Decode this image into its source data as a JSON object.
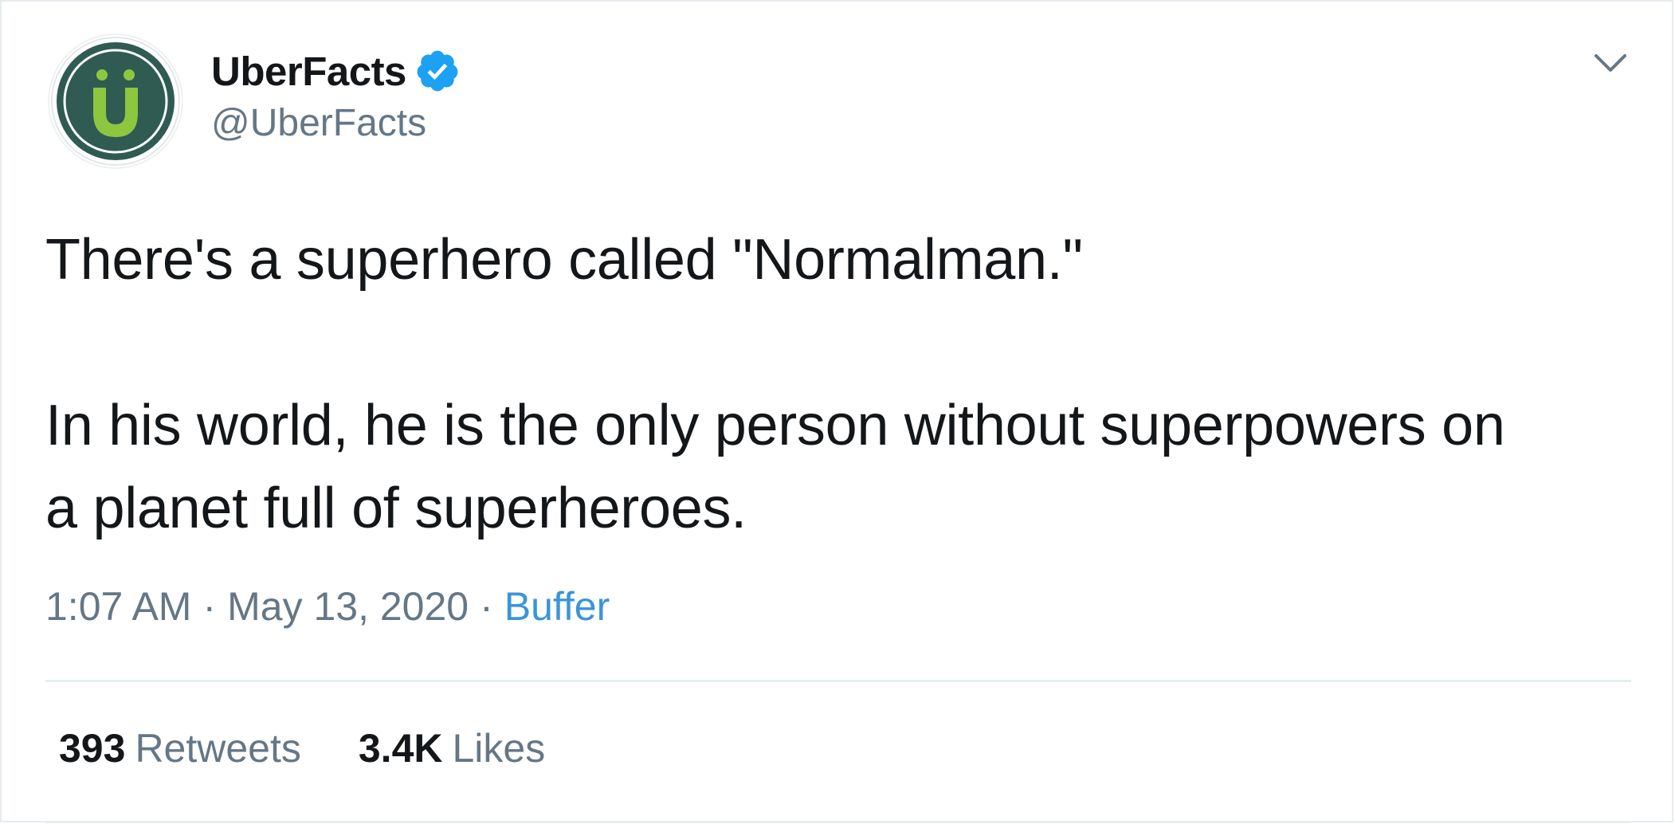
{
  "user": {
    "display_name": "UberFacts",
    "handle": "@UberFacts",
    "verified": true,
    "avatar_icon": "uberfacts-logo-icon",
    "avatar_colors": {
      "ring": "#2f5b52",
      "letter": "#8dc63f"
    }
  },
  "tweet": {
    "lines": [
      "There's a superhero called \"Normalman.\"",
      "In his world, he is the only person without superpowers on",
      "a planet full of superheroes."
    ]
  },
  "meta": {
    "time": "1:07 AM",
    "date": "May 13, 2020",
    "separator": "·",
    "source": "Buffer"
  },
  "stats": {
    "retweets_count": "393",
    "retweets_label": "Retweets",
    "likes_count": "3.4K",
    "likes_label": "Likes"
  },
  "colors": {
    "text": "#14171a",
    "secondary": "#657786",
    "link": "#3b94d9",
    "verified": "#1da1f2",
    "divider": "#e6ecf0"
  }
}
